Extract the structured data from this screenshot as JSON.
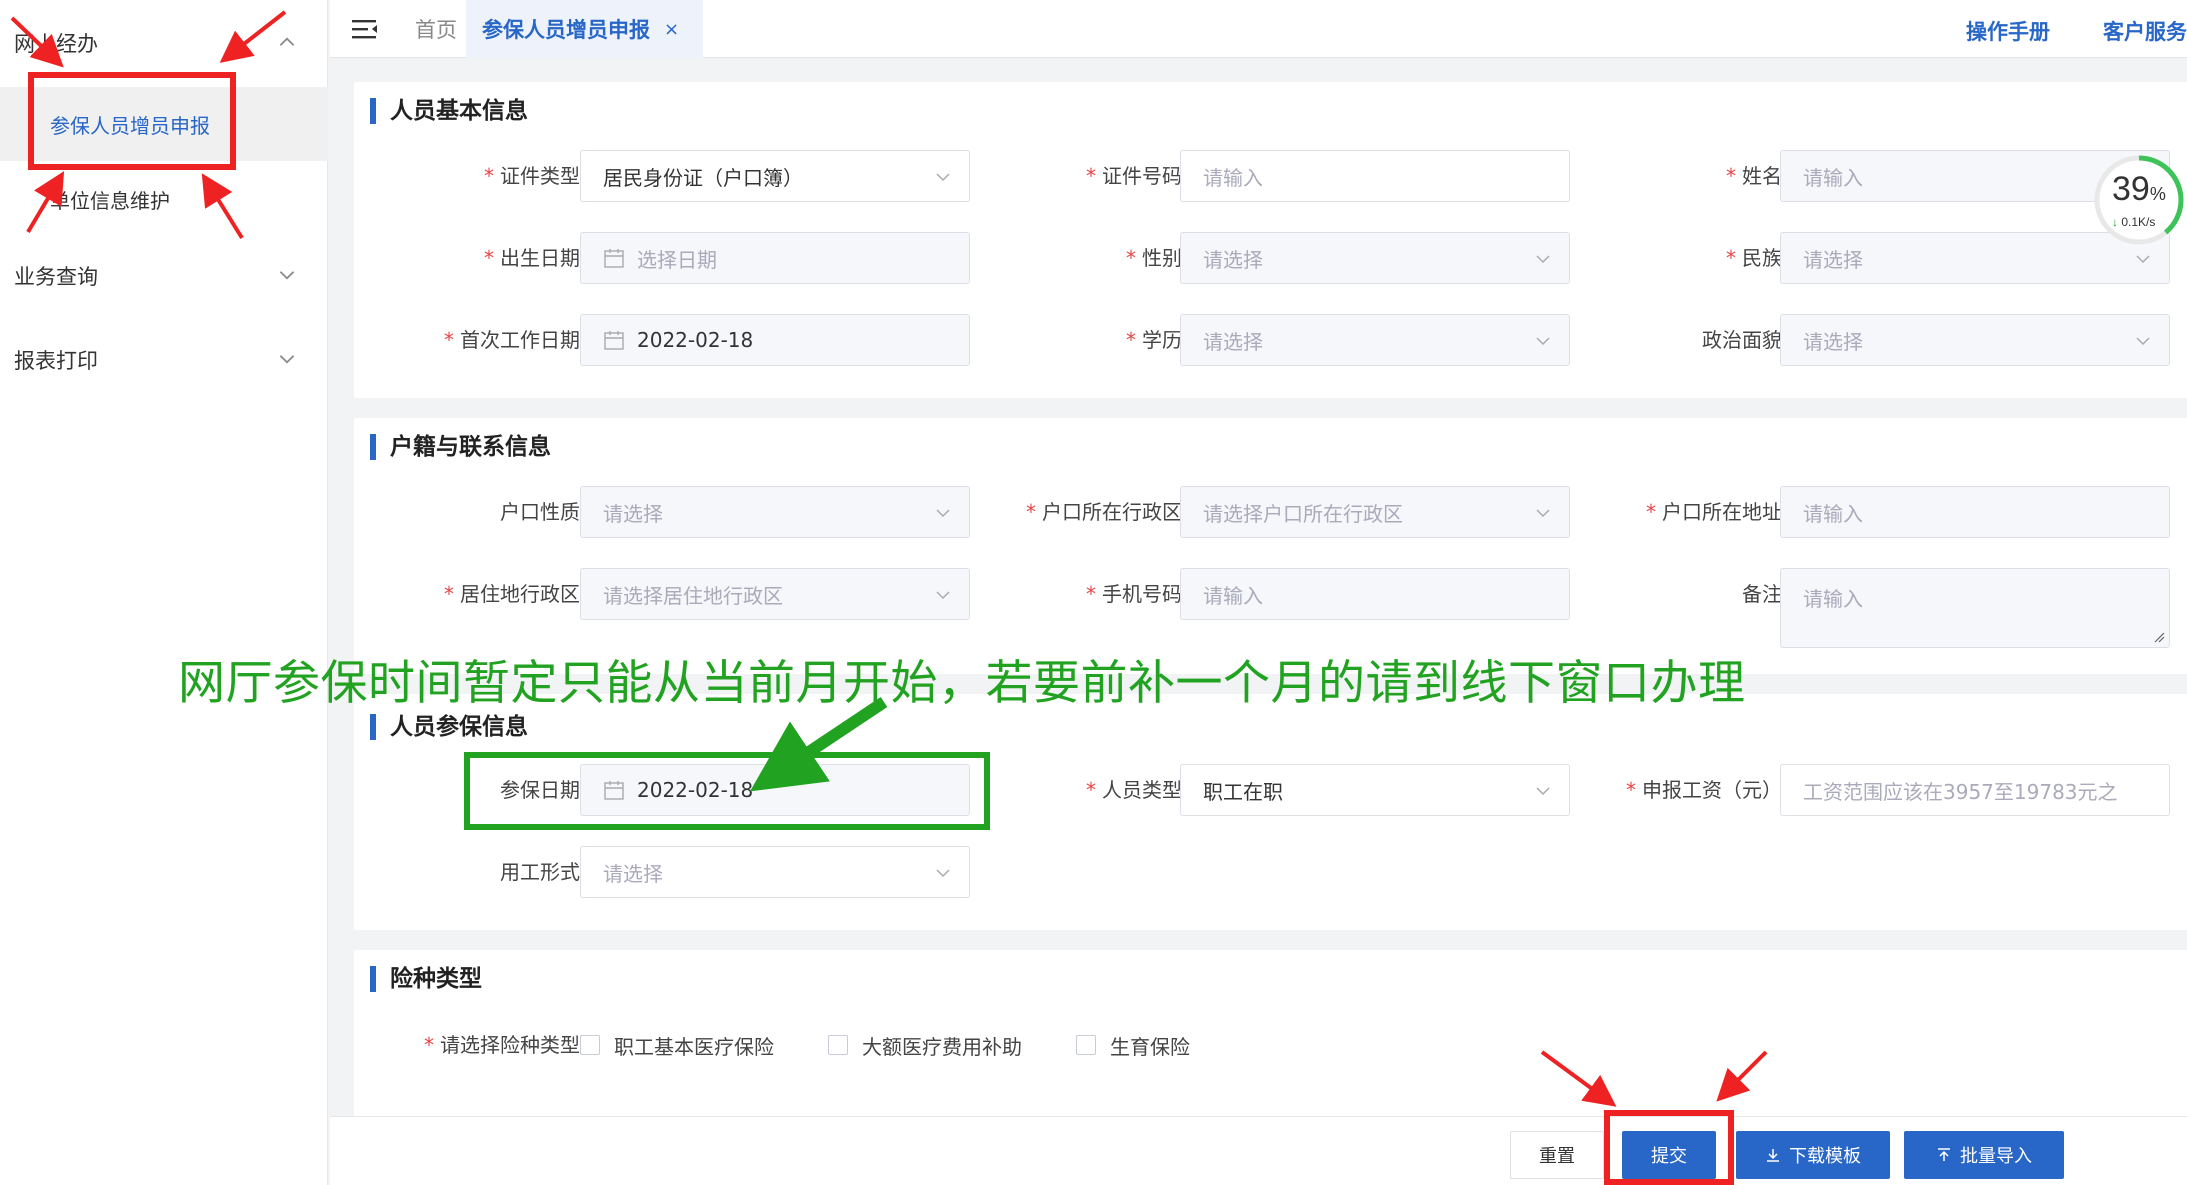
{
  "sidebar": {
    "groups": [
      {
        "label": "网上经办"
      },
      {
        "label": "业务查询"
      },
      {
        "label": "报表打印"
      }
    ],
    "items": [
      {
        "label": "参保人员增员申报"
      },
      {
        "label": "单位信息维护"
      }
    ]
  },
  "topbar": {
    "home_tab": "首页",
    "active_tab": "参保人员增员申报",
    "close_glyph": "×",
    "manual_link": "操作手册",
    "service_link": "客户服务"
  },
  "sections": {
    "basic": {
      "title": "人员基本信息",
      "id_type_label": "证件类型",
      "id_type_value": "居民身份证（户口簿）",
      "id_number_label": "证件号码",
      "id_number_placeholder": "请输入",
      "name_label": "姓名",
      "name_placeholder": "请输入",
      "birth_label": "出生日期",
      "birth_placeholder": "选择日期",
      "gender_label": "性别",
      "gender_placeholder": "请选择",
      "ethnicity_label": "民族",
      "ethnicity_placeholder": "请选择",
      "first_work_label": "首次工作日期",
      "first_work_value": "2022-02-18",
      "education_label": "学历",
      "education_placeholder": "请选择",
      "politics_label": "政治面貌",
      "politics_placeholder": "请选择"
    },
    "household": {
      "title": "户籍与联系信息",
      "hukou_type_label": "户口性质",
      "hukou_type_placeholder": "请选择",
      "hukou_region_label": "户口所在行政区",
      "hukou_region_placeholder": "请选择户口所在行政区",
      "hukou_address_label": "户口所在地址",
      "hukou_address_placeholder": "请输入",
      "residence_label": "居住地行政区",
      "residence_placeholder": "请选择居住地行政区",
      "phone_label": "手机号码",
      "phone_placeholder": "请输入",
      "remark_label": "备注",
      "remark_placeholder": "请输入"
    },
    "insurance": {
      "title": "人员参保信息",
      "date_label": "参保日期",
      "date_value": "2022-02-18",
      "person_type_label": "人员类型",
      "person_type_value": "职工在职",
      "wage_label": "申报工资（元）",
      "wage_placeholder": "工资范围应该在3957至19783元之",
      "employment_label": "用工形式",
      "employment_placeholder": "请选择"
    },
    "types": {
      "title": "险种类型",
      "select_label": "请选择险种类型",
      "options": [
        "职工基本医疗保险",
        "大额医疗费用补助",
        "生育保险"
      ]
    }
  },
  "footer": {
    "reset": "重置",
    "submit": "提交",
    "download_template": "下载模板",
    "batch_import": "批量导入"
  },
  "annotation": {
    "note": "网厅参保时间暂定只能从当前月开始，若要前补一个月的请到线下窗口办理"
  },
  "gauge": {
    "percent": "39",
    "percent_unit": "%",
    "percent_value": 39,
    "speed": "0.1K/s"
  },
  "colors": {
    "primary": "#2866c7",
    "required": "#e64545",
    "annotation_green": "#21a321",
    "annotation_red": "#ee2222"
  }
}
